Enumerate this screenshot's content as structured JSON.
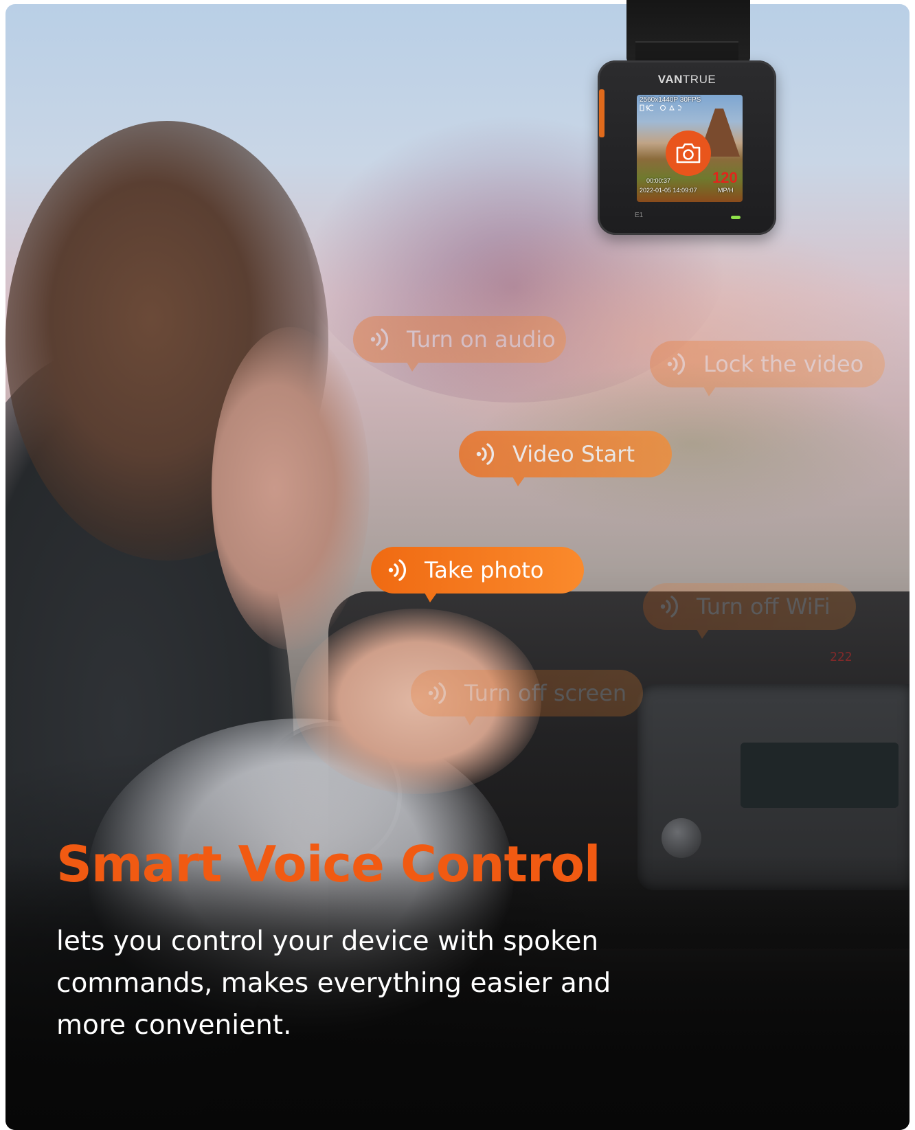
{
  "device": {
    "brand_bold": "VAN",
    "brand_light": "TRUE",
    "model": "E1",
    "screen": {
      "resolution": "2560x1440P 30FPS",
      "record_time": "00:00:37",
      "datetime": "2022-01-05  14:09:07",
      "speed": "120",
      "speed_unit": "MP/H"
    },
    "accent_color": "#e9551c"
  },
  "voice_commands": [
    {
      "label": "Turn on audio"
    },
    {
      "label": "Lock the video"
    },
    {
      "label": "Video Start"
    },
    {
      "label": "Take photo"
    },
    {
      "label": "Turn off WiFi"
    },
    {
      "label": "Turn off screen"
    }
  ],
  "active_command": "Take photo",
  "dashboard_readout": "222",
  "headline": "Smart Voice Control",
  "description": "lets you control your device with spoken commands, makes everything easier and more convenient.",
  "colors": {
    "headline": "#f15a12",
    "bubble_start": "#f06a12",
    "bubble_end": "#fa8a2c",
    "text": "#ffffff"
  }
}
